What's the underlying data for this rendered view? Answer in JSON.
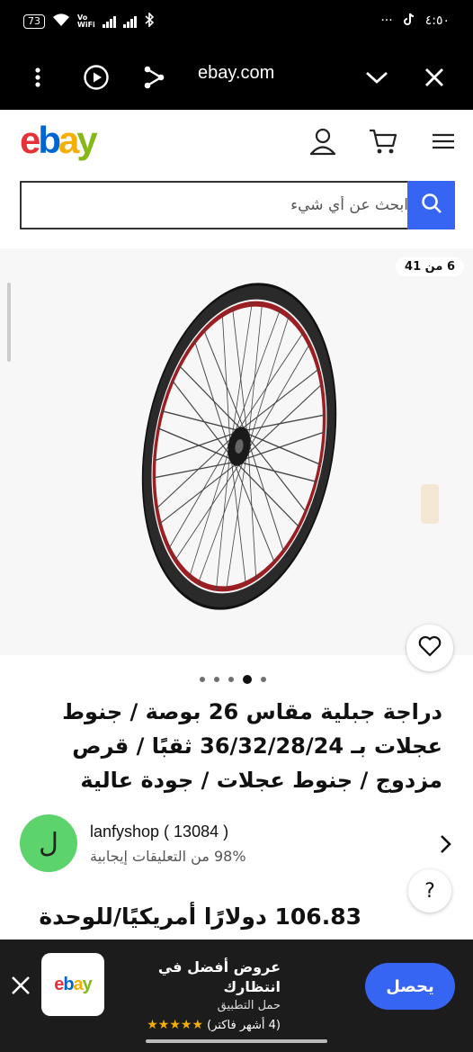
{
  "status_bar": {
    "battery": "73",
    "vowifi_top": "Vo",
    "vowifi_bottom": "WiFi",
    "more": "···",
    "time": "٤:٥٠"
  },
  "browser": {
    "url": "ebay.com"
  },
  "header": {
    "logo_letters": [
      "e",
      "b",
      "a",
      "y"
    ],
    "logo_colors": [
      "#e53238",
      "#0064d2",
      "#f5af02",
      "#86b817"
    ]
  },
  "search": {
    "placeholder": "ابحث عن أي شيء"
  },
  "gallery": {
    "counter": "6 من 41",
    "dots_count": 5,
    "active_dot": 4
  },
  "product": {
    "title": "دراجة جبلية مقاس 26 بوصة / جنوط عجلات بـ 36/32/28/24 ثقبًا / قرص مزدوج / جنوط عجلات / جودة عالية",
    "price": "106.83 دولارًا أمريكيًا/للوحدة"
  },
  "seller": {
    "avatar_letter": "ل",
    "name": "lanfyshop ( 13084 )",
    "rating": "98% من التعليقات إيجابية"
  },
  "help": {
    "label": "?"
  },
  "banner": {
    "logo_text": "ebay",
    "title": "عروض أفضل في انتظارك",
    "subtitle": "حمل التطبيق",
    "stars": 5,
    "reviews": "(4 أشهر فاكتر)",
    "get_label": "يحصل"
  }
}
